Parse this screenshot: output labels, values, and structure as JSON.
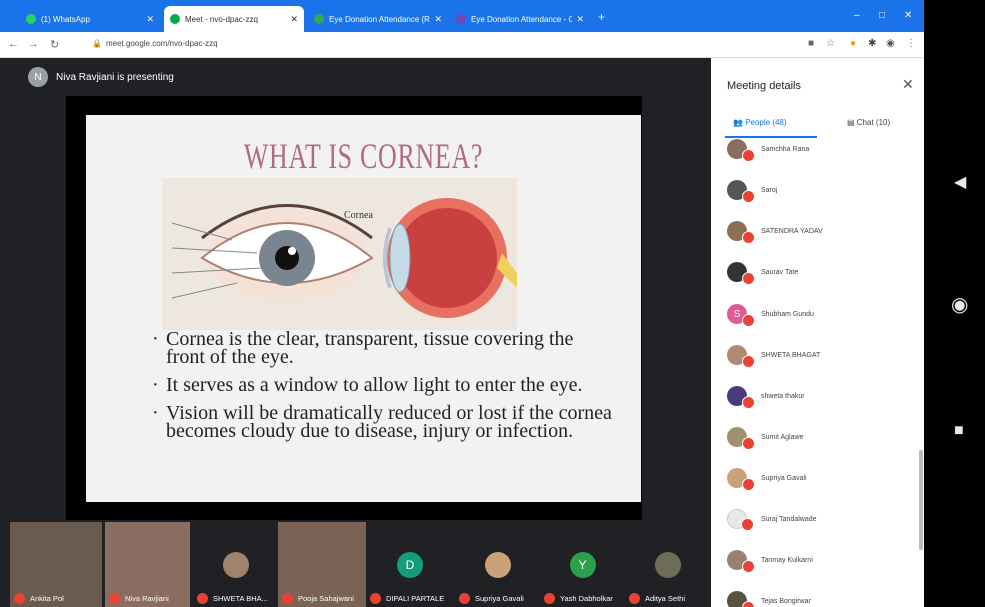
{
  "browser": {
    "tabs": [
      {
        "label": "(1) WhatsApp",
        "color": "#25d366"
      },
      {
        "label": "Meet - nvo-dpac-zzq",
        "color": "#00ac47"
      },
      {
        "label": "Eye Donation Attendance (Resp",
        "color": "#34a853"
      },
      {
        "label": "Eye Donation Attendance - Goo",
        "color": "#7248b9"
      }
    ],
    "new_tab": "+",
    "url": "meet.google.com/nvo-dpac-zzq"
  },
  "presenter": {
    "initial": "N",
    "text": "Niva Ravjiani is presenting"
  },
  "slide": {
    "title": "WHAT IS CORNEA?",
    "bullets": [
      "Cornea is the clear, transparent, tissue covering the front of the eye.",
      "It serves as a window to allow light to enter the eye.",
      "Vision will be dramatically reduced or lost if the cornea becomes cloudy due to disease, injury or infection."
    ],
    "diagram_label": "Cornea"
  },
  "filmstrip": [
    {
      "name": "Ankita Pol",
      "initial": "",
      "color": "#6b5a50"
    },
    {
      "name": "Niva Ravjiani",
      "initial": "",
      "color": "#8a6d60"
    },
    {
      "name": "SHWETA BHA...",
      "initial": "",
      "color": "#a0826d"
    },
    {
      "name": "Pooja Sahajwani",
      "initial": "",
      "color": "#7a6254"
    },
    {
      "name": "DIPALI PARTALE",
      "initial": "D",
      "color": "#129e7a"
    },
    {
      "name": "Supriya Gavali",
      "initial": "",
      "color": "#c9a27a"
    },
    {
      "name": "Yash Dabholkar",
      "initial": "Y",
      "color": "#2aa04a"
    },
    {
      "name": "Aditya Sethi",
      "initial": "",
      "color": "#6d6d5a"
    }
  ],
  "panel": {
    "title": "Meeting details",
    "people_tab": "People (48)",
    "chat_tab": "Chat (10)",
    "people": [
      {
        "name": "Samchha Rana",
        "color": "#8a6d60"
      },
      {
        "name": "Saroj",
        "color": "#555"
      },
      {
        "name": "SATENDRA YADAV",
        "color": "#8a7050"
      },
      {
        "name": "Saurav Tate",
        "color": "#333"
      },
      {
        "name": "Shubham Gundu",
        "color": "#e05a9a",
        "initial": "S"
      },
      {
        "name": "SHWETA BHAGAT",
        "color": "#b08a70"
      },
      {
        "name": "shweta thakur",
        "color": "#4a3a7a"
      },
      {
        "name": "Sumit Aglawe",
        "color": "#a09070"
      },
      {
        "name": "Supriya Gavali",
        "color": "#c9a27a"
      },
      {
        "name": "Suraj Tandalwade",
        "color": "#e8e8e8"
      },
      {
        "name": "Tanmay Kulkarni",
        "color": "#9a8070"
      },
      {
        "name": "Tejas Bongirwar",
        "color": "#5a5040"
      }
    ]
  }
}
